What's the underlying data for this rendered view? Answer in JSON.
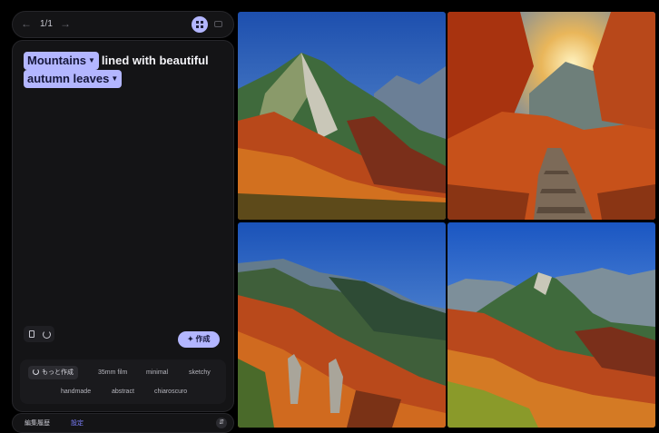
{
  "nav": {
    "prev_icon": "arrow-left-icon",
    "next_icon": "arrow-right-icon",
    "page_count": "1/1",
    "grid_view_icon": "grid-view-icon",
    "single_view_icon": "single-view-icon"
  },
  "prompt": {
    "chip_1": "Mountains",
    "text_1": "lined with beautiful",
    "chip_2": "autumn leaves"
  },
  "actions": {
    "copy_icon": "copy-icon",
    "reset_icon": "reset-icon",
    "create_label": "✦ 作成"
  },
  "suggestions": {
    "more_label": "もっと作成",
    "chips": [
      "35mm film",
      "minimal",
      "sketchy",
      "handmade",
      "abstract",
      "chiaroscuro"
    ]
  },
  "bottom": {
    "history_label": "編集履歴",
    "settings_label": "設定",
    "toggle_icon": "chevron-up-down-icon"
  },
  "images": [
    {
      "scene": "autumn-mountain-valley"
    },
    {
      "scene": "stone-stairs-autumn-trail"
    },
    {
      "scene": "rocky-autumn-slopes"
    },
    {
      "scene": "alpine-autumn-ridge"
    }
  ],
  "colors": {
    "accent": "#b3b6ff",
    "panel": "#141416",
    "background": "#000000"
  }
}
